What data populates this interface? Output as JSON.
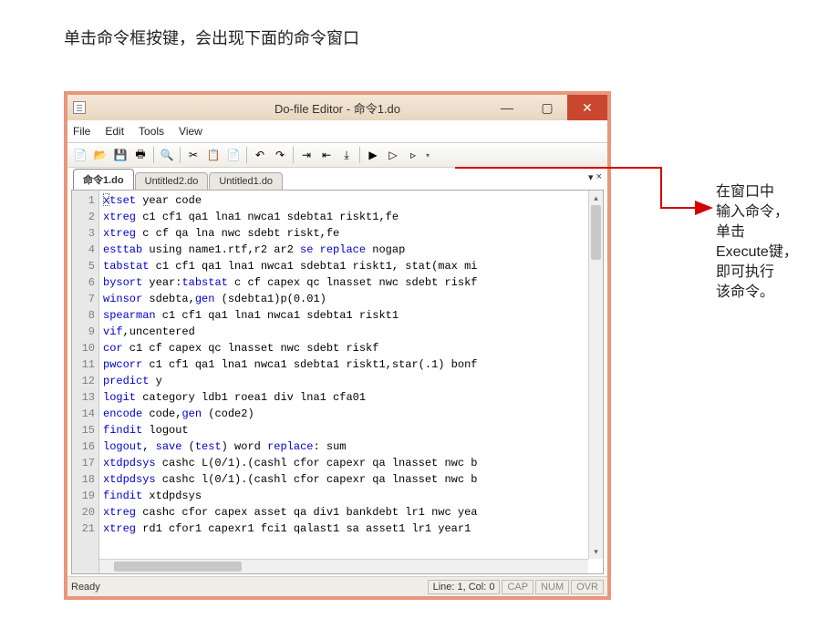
{
  "caption_top": "单击命令框按键，会出现下面的命令窗口",
  "annotation_lines": [
    "在窗口中",
    "输入命令，",
    "单击",
    "Execute键，",
    "即可执行",
    "该命令。"
  ],
  "window": {
    "title": "Do-file Editor - 命令1.do",
    "menu": [
      "File",
      "Edit",
      "Tools",
      "View"
    ],
    "tabs": [
      {
        "label": "命令1.do",
        "active": true
      },
      {
        "label": "Untitled2.do",
        "active": false
      },
      {
        "label": "Untitled1.do",
        "active": false
      }
    ],
    "tab_dropdown": "▾",
    "tab_close": "×",
    "status": {
      "ready": "Ready",
      "pos": "Line: 1, Col: 0",
      "cap": "CAP",
      "num": "NUM",
      "ovr": "OVR"
    },
    "toolbar_icons": [
      "new-icon",
      "open-icon",
      "save-icon",
      "print-icon",
      "sep",
      "find-icon",
      "sep",
      "cut-icon",
      "copy-icon",
      "paste-icon",
      "sep",
      "undo-icon",
      "redo-icon",
      "sep",
      "indent-right-icon",
      "indent-left-icon",
      "bookmark-icon",
      "sep",
      "execute-icon",
      "execute-selection-icon",
      "execute-quiet-icon",
      "dropdown"
    ],
    "win_btns": {
      "min": "—",
      "max": "▢",
      "close": "✕"
    }
  },
  "code": [
    [
      {
        "t": "kw",
        "v": "xtset"
      },
      {
        "t": "plain",
        "v": " year code"
      }
    ],
    [
      {
        "t": "kw",
        "v": "xtreg"
      },
      {
        "t": "plain",
        "v": " c1 cf1 qa1 lna1 nwca1 sdebta1 riskt1,fe"
      }
    ],
    [
      {
        "t": "kw",
        "v": "xtreg"
      },
      {
        "t": "plain",
        "v": " c cf  qa lna nwc sdebt riskt,fe"
      }
    ],
    [
      {
        "t": "kw",
        "v": "esttab"
      },
      {
        "t": "plain",
        "v": " using name1.rtf,r2 ar2 "
      },
      {
        "t": "kw",
        "v": "se replace"
      },
      {
        "t": "plain",
        "v": " nogap"
      }
    ],
    [
      {
        "t": "kw",
        "v": "tabstat"
      },
      {
        "t": "plain",
        "v": " c1 cf1 qa1 lna1 nwca1 sdebta1 riskt1, stat(max mi"
      }
    ],
    [
      {
        "t": "kw",
        "v": "bysort"
      },
      {
        "t": "plain",
        "v": " year:"
      },
      {
        "t": "kw",
        "v": "tabstat"
      },
      {
        "t": "plain",
        "v": " c cf capex qc lnasset nwc sdebt riskf"
      }
    ],
    [
      {
        "t": "kw",
        "v": "winsor"
      },
      {
        "t": "plain",
        "v": " sdebta,"
      },
      {
        "t": "kw",
        "v": "gen"
      },
      {
        "t": "plain",
        "v": " (sdebta1)p(0.01)"
      }
    ],
    [
      {
        "t": "kw",
        "v": "spearman"
      },
      {
        "t": "plain",
        "v": " c1 cf1 qa1 lna1 nwca1 sdebta1 riskt1"
      }
    ],
    [
      {
        "t": "kw",
        "v": "vif"
      },
      {
        "t": "plain",
        "v": ",uncentered"
      }
    ],
    [
      {
        "t": "kw",
        "v": "cor"
      },
      {
        "t": "plain",
        "v": " c1 cf capex qc lnasset nwc sdebt riskf"
      }
    ],
    [
      {
        "t": "kw",
        "v": "pwcorr"
      },
      {
        "t": "plain",
        "v": " c1 cf1 qa1 lna1 nwca1 sdebta1 riskt1,star(.1) bonf"
      }
    ],
    [
      {
        "t": "kw",
        "v": "predict"
      },
      {
        "t": "plain",
        "v": " y"
      }
    ],
    [
      {
        "t": "kw",
        "v": "logit"
      },
      {
        "t": "plain",
        "v": " category ldb1 roea1 div lna1 cfa01"
      }
    ],
    [
      {
        "t": "kw",
        "v": "encode"
      },
      {
        "t": "plain",
        "v": " code,"
      },
      {
        "t": "kw",
        "v": "gen"
      },
      {
        "t": "plain",
        "v": " (code2)"
      }
    ],
    [
      {
        "t": "kw",
        "v": "findit"
      },
      {
        "t": "plain",
        "v": " logout"
      }
    ],
    [
      {
        "t": "kw",
        "v": "logout"
      },
      {
        "t": "plain",
        "v": ", "
      },
      {
        "t": "kw",
        "v": "save"
      },
      {
        "t": "plain",
        "v": " ("
      },
      {
        "t": "kw",
        "v": "test"
      },
      {
        "t": "plain",
        "v": ") word "
      },
      {
        "t": "kw",
        "v": "replace"
      },
      {
        "t": "plain",
        "v": ": sum"
      }
    ],
    [
      {
        "t": "kw",
        "v": "xtdpdsys"
      },
      {
        "t": "plain",
        "v": " cashc L(0/1).(cashl cfor capexr qa lnasset nwc b"
      }
    ],
    [
      {
        "t": "kw",
        "v": "xtdpdsys"
      },
      {
        "t": "plain",
        "v": " cashc l(0/1).(cashl cfor capexr qa lnasset nwc b"
      }
    ],
    [
      {
        "t": "kw",
        "v": "findit"
      },
      {
        "t": "plain",
        "v": " xtdpdsys"
      }
    ],
    [
      {
        "t": "kw",
        "v": "xtreg"
      },
      {
        "t": "plain",
        "v": " cashc cfor capex asset qa div1 bankdebt lr1 nwc yea"
      }
    ],
    [
      {
        "t": "kw",
        "v": "xtreg"
      },
      {
        "t": "plain",
        "v": " rd1 cfor1 capexr1 fci1 qalast1 sa asset1 lr1 year1"
      }
    ]
  ]
}
